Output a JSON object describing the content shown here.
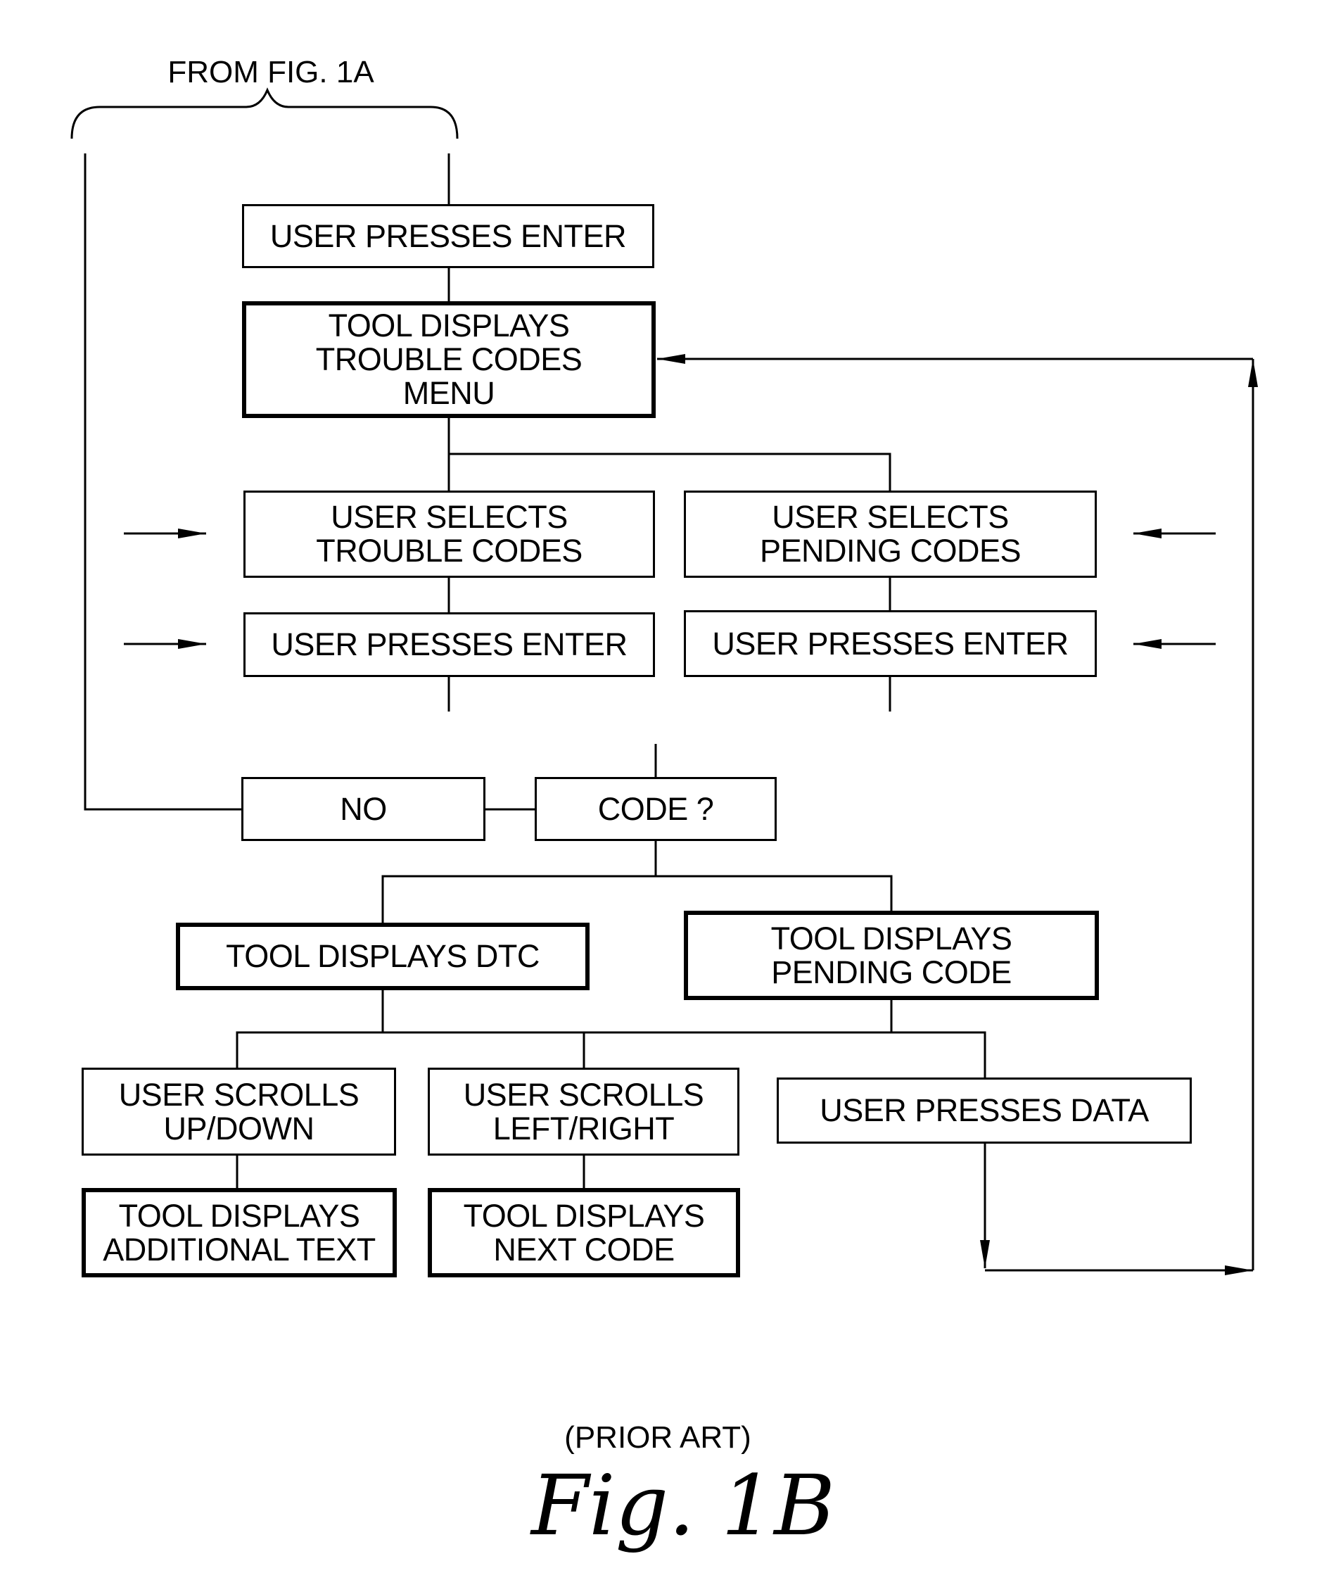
{
  "figure": {
    "from_label": "FROM FIG. 1A",
    "prior_art": "(PRIOR ART)",
    "caption": "Fig. 1B"
  },
  "nodes": {
    "enter_top": "USER PRESSES ENTER",
    "trouble_menu": "TOOL DISPLAYS\nTROUBLE CODES\nMENU",
    "select_trouble": "USER SELECTS\nTROUBLE CODES",
    "select_pending": "USER SELECTS\nPENDING CODES",
    "enter_trouble": "USER PRESSES ENTER",
    "enter_pending": "USER PRESSES ENTER",
    "no": "NO",
    "code_q": "CODE ?",
    "displays_dtc": "TOOL DISPLAYS DTC",
    "displays_pending": "TOOL DISPLAYS\nPENDING CODE",
    "scroll_updown": "USER SCROLLS\nUP/DOWN",
    "scroll_leftright": "USER SCROLLS\nLEFT/RIGHT",
    "presses_data": "USER PRESSES DATA",
    "additional_text": "TOOL DISPLAYS\nADDITIONAL TEXT",
    "next_code": "TOOL DISPLAYS\nNEXT CODE"
  }
}
